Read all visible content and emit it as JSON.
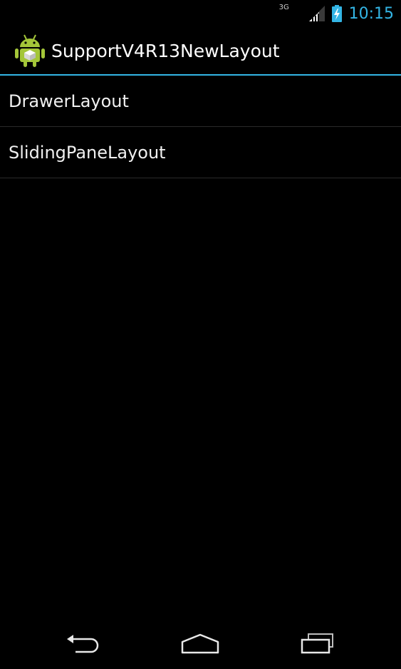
{
  "status_bar": {
    "network_type": "3G",
    "clock": "10:15",
    "accent_color": "#33b5e5",
    "icons": [
      "signal-icon",
      "battery-charging-icon"
    ]
  },
  "action_bar": {
    "app_icon": "android-app-icon",
    "title": "SupportV4R13NewLayout",
    "divider_color": "#33b5e5"
  },
  "list": {
    "items": [
      {
        "label": "DrawerLayout"
      },
      {
        "label": "SlidingPaneLayout"
      }
    ]
  },
  "nav_bar": {
    "buttons": [
      "back-icon",
      "home-icon",
      "recents-icon"
    ]
  }
}
